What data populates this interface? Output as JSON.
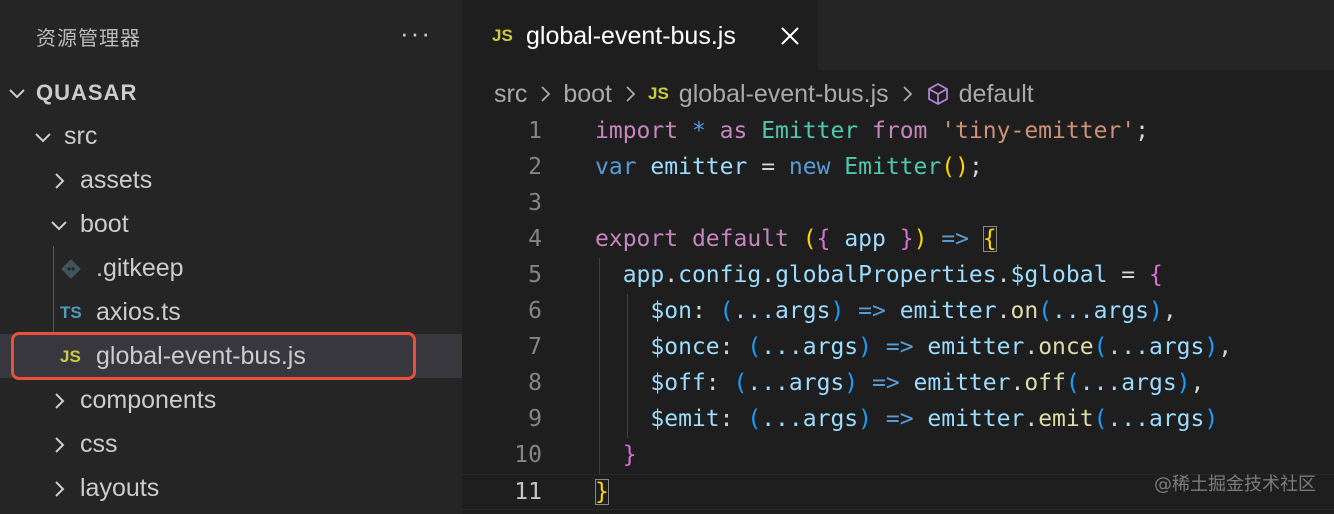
{
  "explorer": {
    "title": "资源管理器",
    "more": "···",
    "section": "QUASAR",
    "items": [
      {
        "label": "src",
        "icon": "chevron-down-icon"
      },
      {
        "label": "assets",
        "icon": "chevron-right-icon"
      },
      {
        "label": "boot",
        "icon": "chevron-down-icon"
      },
      {
        "label": ".gitkeep",
        "icon": "git-icon"
      },
      {
        "label": "axios.ts",
        "icon_text": "TS"
      },
      {
        "label": "global-event-bus.js",
        "icon_text": "JS"
      },
      {
        "label": "components",
        "icon": "chevron-right-icon"
      },
      {
        "label": "css",
        "icon": "chevron-right-icon"
      },
      {
        "label": "layouts",
        "icon": "chevron-right-icon"
      }
    ]
  },
  "editor": {
    "tab": {
      "icon_text": "JS",
      "label": "global-event-bus.js"
    },
    "breadcrumb": [
      "src",
      "boot",
      "global-event-bus.js",
      "default"
    ],
    "breadcrumb_js": "JS",
    "line_numbers": [
      "1",
      "2",
      "3",
      "4",
      "5",
      "6",
      "7",
      "8",
      "9",
      "10",
      "11"
    ],
    "code": {
      "l1": {
        "import": "import",
        "star": " * ",
        "as": "as",
        "sp": " ",
        "emitter": "Emitter",
        "sp2": " ",
        "from": "from",
        "sp3": " ",
        "str": "'tiny-emitter'",
        "semi": ";"
      },
      "l2": {
        "var": "var",
        "sp": " ",
        "emitter": "emitter",
        "eq": " = ",
        "new": "new",
        "sp2": " ",
        "cls": "Emitter",
        "open": "(",
        "close": ")",
        "semi": ";"
      },
      "l4": {
        "export": "export",
        "sp": " ",
        "default": "default",
        "sp2": " ",
        "open": "(",
        "brace": "{",
        "app": " app ",
        "brace2": "}",
        "close": ")",
        "arrow": " => ",
        "ob": "{"
      },
      "l5": {
        "indent": "  ",
        "app": "app",
        "d1": ".",
        "config": "config",
        "d2": ".",
        "gp": "globalProperties",
        "d3": ".",
        "g": "$global",
        "eq": " = ",
        "ob": "{"
      },
      "l6": {
        "indent": "    ",
        "key": "$on",
        "colon": ": ",
        "open": "(",
        "args": "...args",
        "close": ")",
        "arrow": " => ",
        "em": "emitter",
        "dot": ".",
        "fn": "on",
        "o2": "(",
        "a2": "...args",
        "c2": ")",
        "comma": ","
      },
      "l7": {
        "indent": "    ",
        "key": "$once",
        "colon": ": ",
        "open": "(",
        "args": "...args",
        "close": ")",
        "arrow": " => ",
        "em": "emitter",
        "dot": ".",
        "fn": "once",
        "o2": "(",
        "a2": "...args",
        "c2": ")",
        "comma": ","
      },
      "l8": {
        "indent": "    ",
        "key": "$off",
        "colon": ": ",
        "open": "(",
        "args": "...args",
        "close": ")",
        "arrow": " => ",
        "em": "emitter",
        "dot": ".",
        "fn": "off",
        "o2": "(",
        "a2": "...args",
        "c2": ")",
        "comma": ","
      },
      "l9": {
        "indent": "    ",
        "key": "$emit",
        "colon": ": ",
        "open": "(",
        "args": "...args",
        "close": ")",
        "arrow": " => ",
        "em": "emitter",
        "dot": ".",
        "fn": "emit",
        "o2": "(",
        "a2": "...args",
        "c2": ")"
      },
      "l10": {
        "indent": "  ",
        "cb": "}"
      },
      "l11": {
        "cb": "}"
      }
    }
  },
  "watermark": "@稀土掘金技术社区",
  "colors": {
    "accent_highlight": "#e8503a",
    "js_icon": "#cbcb41",
    "ts_icon": "#519aba"
  }
}
